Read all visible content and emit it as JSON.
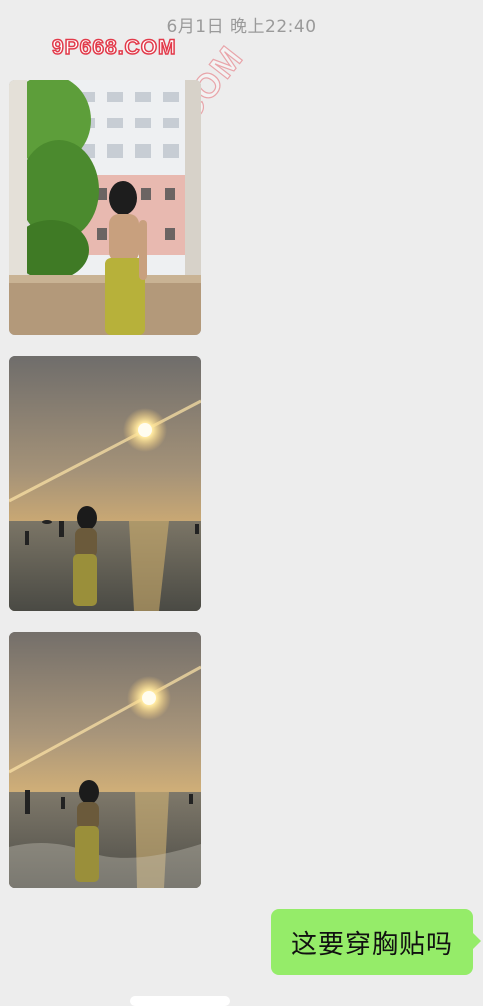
{
  "chat": {
    "timestamp": "6月1日 晚上22:40",
    "watermark_top": "9P668.COM",
    "watermark_diag": "9P668.COM",
    "messages": [
      {
        "type": "image",
        "description": "balcony-photo"
      },
      {
        "type": "image",
        "description": "beach-sunset-photo-1"
      },
      {
        "type": "image",
        "description": "beach-sunset-photo-2"
      },
      {
        "type": "text",
        "sender": "self",
        "text": "这要穿胸贴吗"
      }
    ]
  },
  "colors": {
    "background": "#ededed",
    "self_bubble": "#95ec69",
    "timestamp": "#9a9a9a",
    "watermark": "#e23a4a"
  }
}
